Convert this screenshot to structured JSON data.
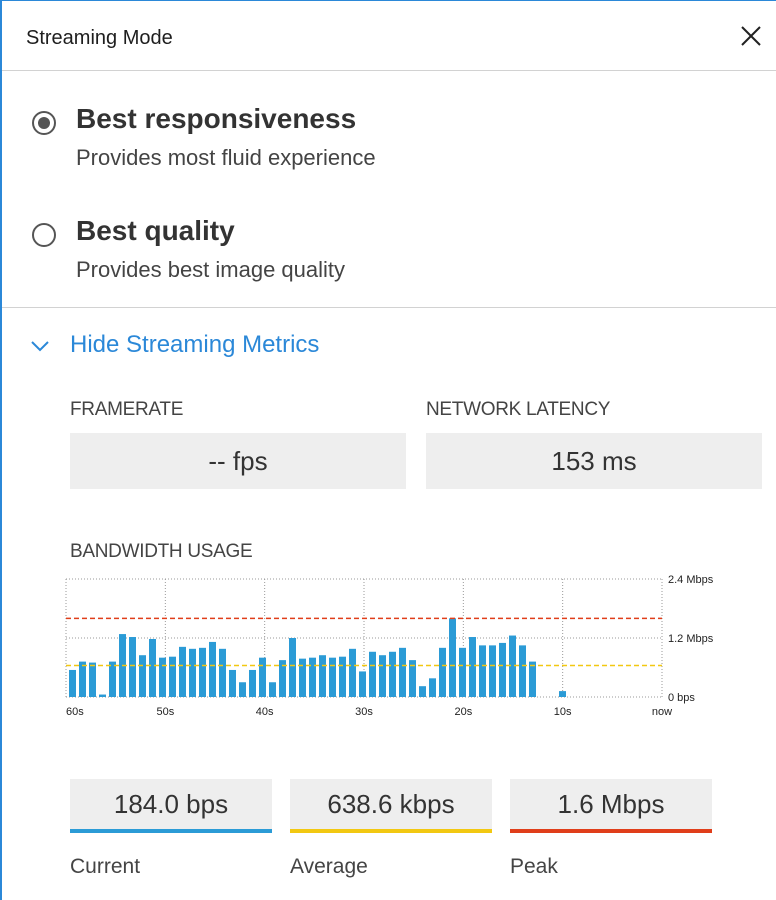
{
  "window": {
    "title": "Streaming Mode",
    "close_icon": "close-icon"
  },
  "options": [
    {
      "title": "Best responsiveness",
      "description": "Provides most fluid experience",
      "selected": true
    },
    {
      "title": "Best quality",
      "description": "Provides best image quality",
      "selected": false
    }
  ],
  "metrics_toggle": {
    "label": "Hide Streaming Metrics",
    "icon": "chevron-down-icon",
    "color": "#2b88d8"
  },
  "framerate": {
    "label": "FRAMERATE",
    "value": "-- fps"
  },
  "latency": {
    "label": "NETWORK LATENCY",
    "value": "153 ms"
  },
  "bandwidth": {
    "label": "BANDWIDTH USAGE"
  },
  "chart_data": {
    "type": "bar",
    "x_ticks": [
      "60s",
      "50s",
      "40s",
      "30s",
      "20s",
      "10s",
      "now"
    ],
    "y_ticks": [
      "2.4 Mbps",
      "1.2 Mbps",
      "0 bps"
    ],
    "ylim": [
      0,
      2.4
    ],
    "grid": true,
    "bar_color": "#2b9bd6",
    "series": [
      {
        "values": [
          0.55,
          0.72,
          0.7,
          0.05,
          0.72,
          1.28,
          1.22,
          0.85,
          1.18,
          0.8,
          0.82,
          1.02,
          0.98,
          1.0,
          1.12,
          0.98,
          0.55,
          0.3,
          0.55,
          0.8,
          0.3,
          0.75,
          1.2,
          0.78,
          0.8,
          0.85,
          0.8,
          0.82,
          0.98,
          0.52,
          0.92,
          0.85,
          0.92,
          1.0,
          0.75,
          0.22,
          0.38,
          1.0,
          1.6,
          1.0,
          1.22,
          1.05,
          1.05,
          1.1,
          1.25,
          1.05,
          0.72,
          0,
          0,
          0.12
        ]
      }
    ],
    "reference_lines": [
      {
        "name": "Average",
        "value": 0.64,
        "color": "#f2c811"
      },
      {
        "name": "Peak",
        "value": 1.6,
        "color": "#e03e1a"
      }
    ]
  },
  "stats": [
    {
      "value": "184.0 bps",
      "caption": "Current",
      "color": "#2b9bd6"
    },
    {
      "value": "638.6 kbps",
      "caption": "Average",
      "color": "#f2c811"
    },
    {
      "value": "1.6 Mbps",
      "caption": "Peak",
      "color": "#e03e1a"
    }
  ]
}
